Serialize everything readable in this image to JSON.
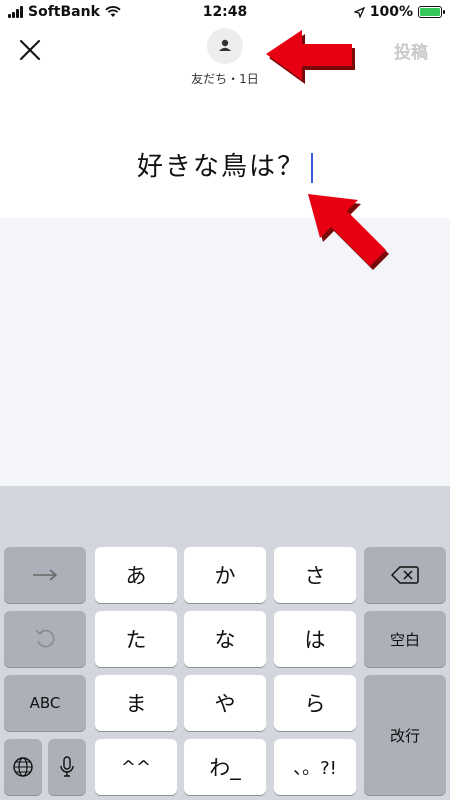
{
  "status_bar": {
    "carrier": "SoftBank",
    "time": "12:48",
    "battery": "100%"
  },
  "header": {
    "audience_label": "友だち・1日",
    "post_label": "投稿"
  },
  "compose": {
    "text": "好きな鳥は？"
  },
  "keyboard": {
    "rows": [
      [
        "あ",
        "か",
        "さ"
      ],
      [
        "た",
        "な",
        "は"
      ],
      [
        "ま",
        "や",
        "ら"
      ],
      [
        "^^",
        "わ_",
        "、。?!"
      ]
    ],
    "abc_label": "ABC",
    "space_label": "空白",
    "return_label": "改行"
  },
  "colors": {
    "accent_caret": "#3b5bdb",
    "arrow": "#e60012",
    "battery_green": "#35c759"
  }
}
